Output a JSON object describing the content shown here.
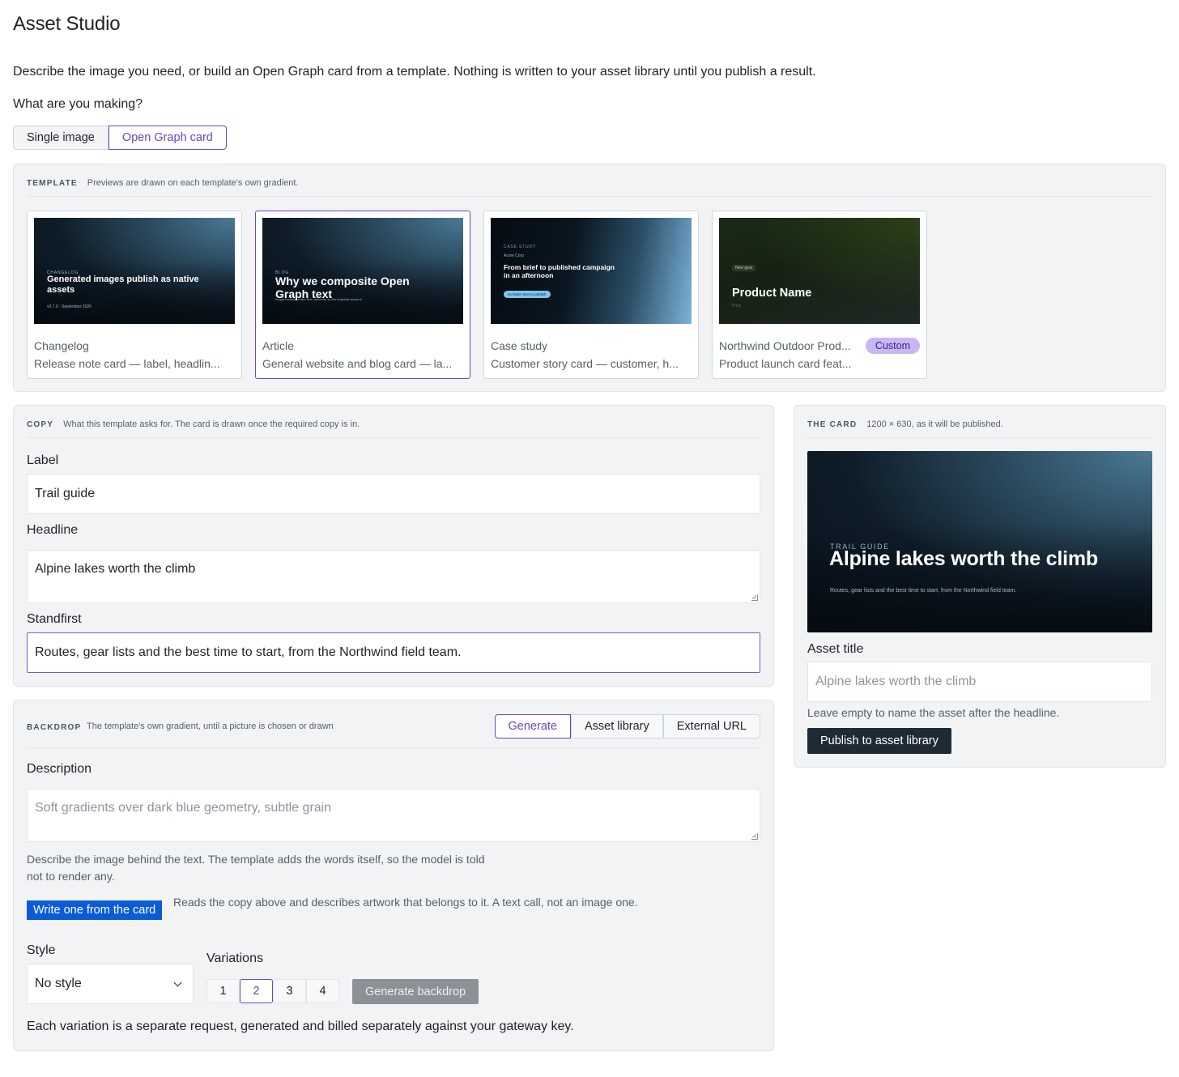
{
  "page": {
    "title": "Asset Studio",
    "intro": "Describe the image you need, or build an Open Graph card from a template. Nothing is written to your asset library until you publish a result.",
    "question": "What are you making?",
    "modes": [
      "Single image",
      "Open Graph card"
    ],
    "active_mode": "Open Graph card"
  },
  "template": {
    "eyebrow": "TEMPLATE",
    "hint": "Previews are drawn on each template's own gradient.",
    "cards": [
      {
        "name": "Changelog",
        "description": "Release note card — label, headlin...",
        "thumb": {
          "eyebrow": "CHANGELOG",
          "title": "Generated images publish as native assets",
          "meta": "v0.7.0 · September 2026"
        }
      },
      {
        "name": "Article",
        "description": "General website and blog card — la...",
        "selected": true,
        "thumb": {
          "eyebrow": "BLOG",
          "title": "Why we composite Open Graph text",
          "meta": "Image models render text unevenly, so the template draws it."
        }
      },
      {
        "name": "Case study",
        "description": "Customer story card — customer, h...",
        "thumb": {
          "eyebrow": "CASE STUDY",
          "customer": "Acme Corp",
          "title": "From brief to published campaign in an afternoon",
          "pill": "3x faster time to publish"
        }
      },
      {
        "name": "Northwind Outdoor Prod...",
        "description": "Product launch card feat...",
        "badge": "Custom",
        "thumb": {
          "badge": "New gear",
          "title": "Product Name",
          "meta": "Price"
        }
      }
    ]
  },
  "copy": {
    "eyebrow": "COPY",
    "hint": "What this template asks for. The card is drawn once the required copy is in.",
    "fields": {
      "label": {
        "label": "Label",
        "value": "Trail guide"
      },
      "headline": {
        "label": "Headline",
        "value": "Alpine lakes worth the climb"
      },
      "standfirst": {
        "label": "Standfirst",
        "value": "Routes, gear lists and the best time to start, from the Northwind field team."
      }
    }
  },
  "card": {
    "eyebrow": "THE CARD",
    "hint": "1200 × 630, as it will be published.",
    "preview": {
      "eyebrow": "TRAIL GUIDE",
      "title": "Alpine lakes worth the climb",
      "subtitle": "Routes, gear lists and the best time to start, from the Northwind field team."
    },
    "asset_title_label": "Asset title",
    "asset_title_placeholder": "Alpine lakes worth the climb",
    "asset_title_help": "Leave empty to name the asset after the headline.",
    "publish_label": "Publish to asset library"
  },
  "backdrop": {
    "eyebrow": "BACKDROP",
    "hint": "The template's own gradient, until a picture is chosen or drawn",
    "tabs": [
      "Generate",
      "Asset library",
      "External URL"
    ],
    "active_tab": "Generate",
    "description_label": "Description",
    "description_placeholder": "Soft gradients over dark blue geometry, subtle grain",
    "description_help": "Describe the image behind the text. The template adds the words itself, so the model is told not to render any.",
    "write_button": "Write one from the card",
    "write_help": "Reads the copy above and describes artwork that belongs to it. A text call, not an image one.",
    "style_label": "Style",
    "style_value": "No style",
    "variations_label": "Variations",
    "variations": [
      "1",
      "2",
      "3",
      "4"
    ],
    "selected_variation": "2",
    "generate_button": "Generate backdrop",
    "footnote": "Each variation is a separate request, generated and billed separately against your gateway key."
  }
}
